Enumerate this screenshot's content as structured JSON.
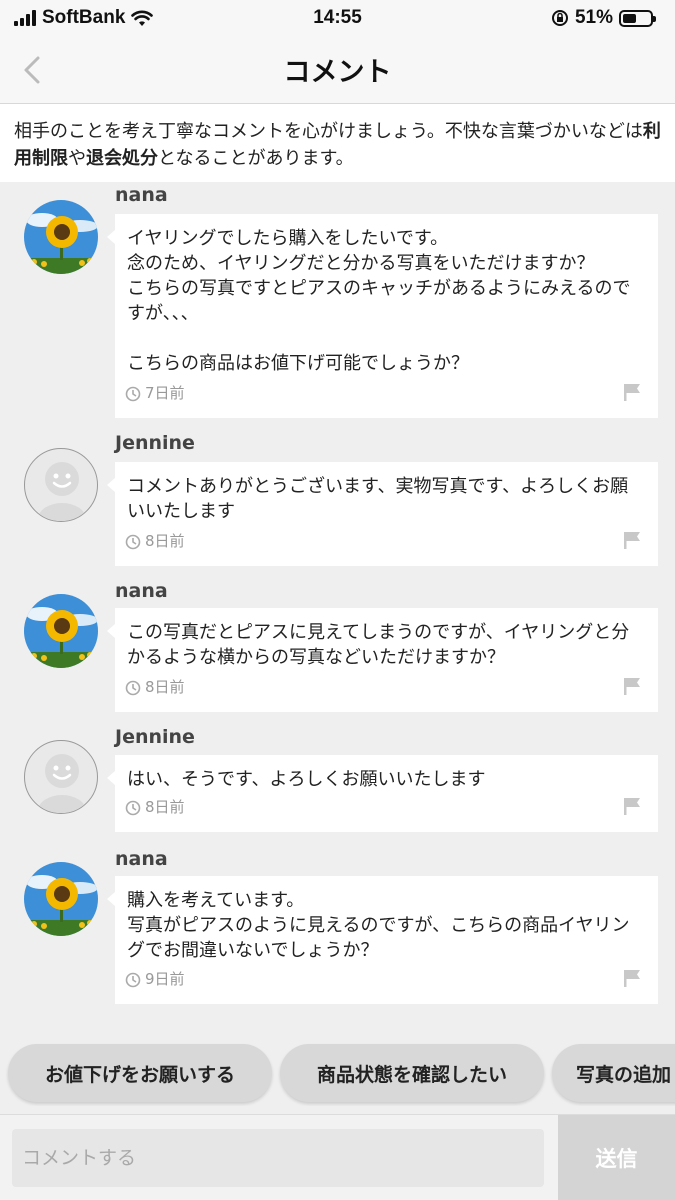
{
  "status_bar": {
    "carrier": "SoftBank",
    "time": "14:55",
    "battery": "51%",
    "battery_level": 0.51
  },
  "header": {
    "title": "コメント",
    "back_icon": "chevron-left-icon"
  },
  "notice": {
    "text_1": "相手のことを考え丁寧なコメントを心がけましょう。不快な言葉づかいなどは",
    "bold_1": "利用制限",
    "text_2": "や",
    "bold_2": "退会処分",
    "text_3": "となることがあります。"
  },
  "comments": [
    {
      "user": "nana",
      "text": "イヤリングでしたら購入をしたいです。\n念のため、イヤリングだと分かる写真をいただけますか？\nこちらの写真ですとピアスのキャッチがあるようにみえるのですが、、、\n\nこちらの商品はお値下げ可能でしょうか？",
      "time": "7日前"
    },
    {
      "user": "Jennine",
      "text": "コメントありがとうございます、実物写真です、よろしくお願いいたします",
      "time": "8日前"
    },
    {
      "user": "nana",
      "text": "この写真だとピアスに見えてしまうのですが、イヤリングと分かるような横からの写真などいただけますか？",
      "time": "8日前"
    },
    {
      "user": "Jennine",
      "text": "はい、そうです、よろしくお願いいたします",
      "time": "8日前"
    },
    {
      "user": "nana",
      "text": "購入を考えています。\n写真がピアスのように見えるのですが、こちらの商品イヤリングでお間違いないでしょうか？",
      "time": "9日前"
    }
  ],
  "quick_replies": [
    "お値下げをお願いする",
    "商品状態を確認したい",
    "写真の追加"
  ],
  "input": {
    "placeholder": "コメントする",
    "send_label": "送信"
  }
}
